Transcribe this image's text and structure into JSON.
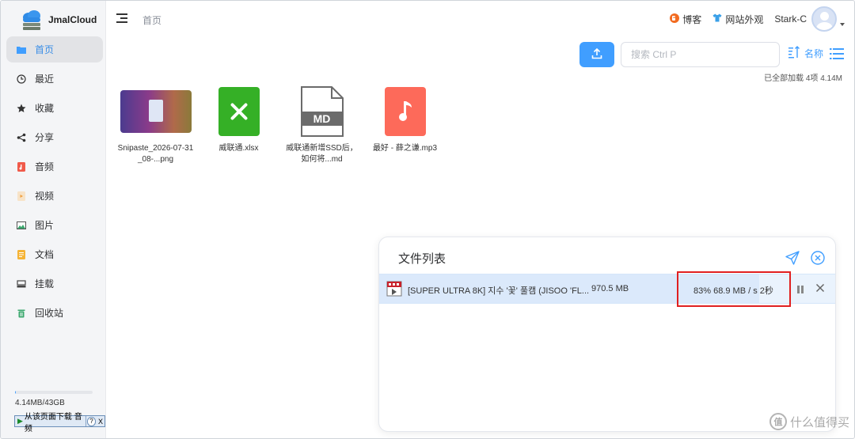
{
  "app": {
    "name": "JmalCloud",
    "brand_color": "#409eff"
  },
  "sidebar": {
    "items": [
      {
        "label": "首页",
        "icon": "folder-icon",
        "active": true
      },
      {
        "label": "最近",
        "icon": "clock-icon"
      },
      {
        "label": "收藏",
        "icon": "star-icon"
      },
      {
        "label": "分享",
        "icon": "share-icon"
      },
      {
        "label": "音频",
        "icon": "audio-icon"
      },
      {
        "label": "视频",
        "icon": "video-icon"
      },
      {
        "label": "图片",
        "icon": "image-icon"
      },
      {
        "label": "文档",
        "icon": "document-icon"
      },
      {
        "label": "挂载",
        "icon": "mount-icon"
      },
      {
        "label": "回收站",
        "icon": "trash-icon"
      }
    ],
    "storage": {
      "text": "4.14MB/43GB",
      "used_fraction": 0.0001
    },
    "download_toolbar": {
      "label": "从该页面下载 音频",
      "help": "?",
      "close": "X"
    }
  },
  "header": {
    "breadcrumb": "首页",
    "links": [
      {
        "label": "博客",
        "icon": "blog-icon"
      },
      {
        "label": "网站外观",
        "icon": "tshirt-icon"
      }
    ],
    "username": "Stark-C"
  },
  "toolbar": {
    "search_placeholder": "搜索 Ctrl P",
    "sort_label": "名称",
    "summary": "已全部加载 4项 4.14M"
  },
  "files": [
    {
      "name": "Snipaste_2026-07-31_08-...png",
      "type": "image"
    },
    {
      "name": "威联通.xlsx",
      "type": "xlsx"
    },
    {
      "name": "威联通新增SSD后，如何将...md",
      "type": "md",
      "badge": "MD"
    },
    {
      "name": "最好 - 薛之谦.mp3",
      "type": "mp3"
    }
  ],
  "transfer_panel": {
    "title": "文件列表",
    "tasks": [
      {
        "name": "[SUPER ULTRA 8K] 지수 '꽃' 풀캠 (JISOO 'FL...",
        "size": "970.5 MB",
        "speed": "83% 68.9 MB / s 2秒",
        "progress": 0.83
      }
    ]
  },
  "watermark": {
    "text": "什么值得买",
    "logo": "值"
  }
}
